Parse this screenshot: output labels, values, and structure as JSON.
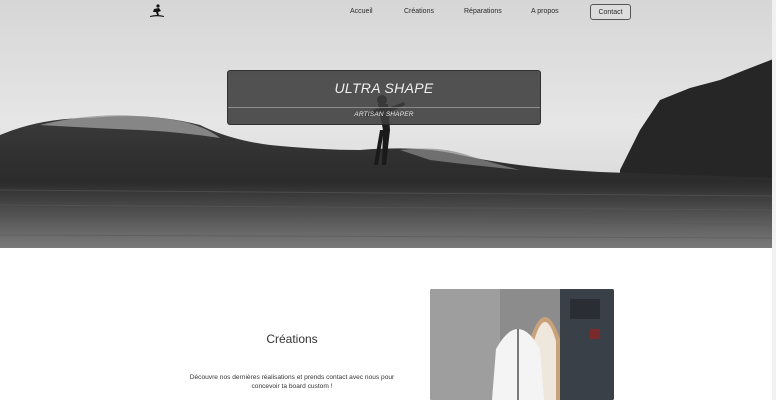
{
  "nav": {
    "logo_icon": "surfer-icon",
    "links": [
      "Accueil",
      "Créations",
      "Réparations",
      "A propos"
    ],
    "contact_label": "Contact"
  },
  "hero": {
    "title": "ULTRA SHAPE",
    "subtitle": "ARTISAN SHAPER"
  },
  "creations": {
    "title": "Créations",
    "text": "Découvre nos dernières réalisations et prends contact avec nous pour concevoir ta board custom !"
  },
  "colors": {
    "card_bg": "#3c3c3c",
    "text_dark": "#2b2b2b"
  }
}
